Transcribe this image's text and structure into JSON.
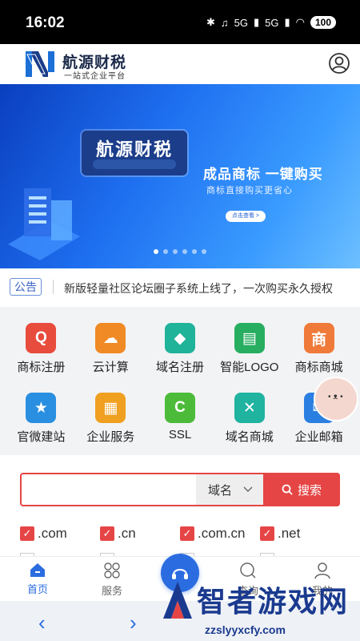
{
  "status_bar": {
    "time": "16:02",
    "signal_1": "5G",
    "signal_2": "5G",
    "battery": "100"
  },
  "header": {
    "brand_name": "航源财税",
    "slogan": "一站式企业平台"
  },
  "banner": {
    "title": "航源财税",
    "headline": "成品商标  一键购买",
    "subline": "商标直接购买更省心",
    "button": "点击查看 >",
    "dot_count": 6,
    "active_dot": 0
  },
  "notice": {
    "tag": "公告",
    "text": "新版轻量社区论坛圈子系统上线了，一次购买永久授权"
  },
  "services": [
    {
      "label": "商标注册",
      "icon": "trademark-register-icon",
      "color": "#e84c3d",
      "glyph": "Q"
    },
    {
      "label": "云计算",
      "icon": "cloud-computing-icon",
      "color": "#f08a24",
      "glyph": "☁"
    },
    {
      "label": "域名注册",
      "icon": "domain-register-icon",
      "color": "#1fb39a",
      "glyph": "◆"
    },
    {
      "label": "智能LOGO",
      "icon": "smart-logo-icon",
      "color": "#27ae60",
      "glyph": "▤"
    },
    {
      "label": "商标商城",
      "icon": "trademark-mall-icon",
      "color": "#f07a3a",
      "glyph": "商"
    },
    {
      "label": "官微建站",
      "icon": "website-build-icon",
      "color": "#2a8fe0",
      "glyph": "★"
    },
    {
      "label": "企业服务",
      "icon": "enterprise-service-icon",
      "color": "#f0a020",
      "glyph": "▦"
    },
    {
      "label": "SSL",
      "icon": "ssl-icon",
      "color": "#4cbb3a",
      "glyph": "C"
    },
    {
      "label": "域名商城",
      "icon": "domain-mall-icon",
      "color": "#1fb3a0",
      "glyph": "✕"
    },
    {
      "label": "企业邮箱",
      "icon": "enterprise-mail-icon",
      "color": "#2a7fe0",
      "glyph": "✉"
    }
  ],
  "search": {
    "placeholder": "",
    "select_value": "域名",
    "button_label": "搜索"
  },
  "tlds": [
    {
      "label": ".com",
      "checked": true
    },
    {
      "label": ".cn",
      "checked": true
    },
    {
      "label": ".com.cn",
      "checked": true
    },
    {
      "label": ".net",
      "checked": true
    }
  ],
  "bottom_nav": [
    {
      "label": "首页",
      "icon": "home-icon",
      "active": true
    },
    {
      "label": "服务",
      "icon": "services-icon",
      "active": false
    },
    {
      "label": "查询",
      "icon": "search-icon",
      "active": false
    },
    {
      "label": "我的",
      "icon": "user-icon",
      "active": false
    }
  ],
  "watermark": {
    "title": "智者游戏网",
    "url": "zzslyyxcfy.com"
  },
  "colors": {
    "accent": "#2b6de0",
    "danger": "#e64545",
    "banner_dark": "#0a3fbf"
  }
}
